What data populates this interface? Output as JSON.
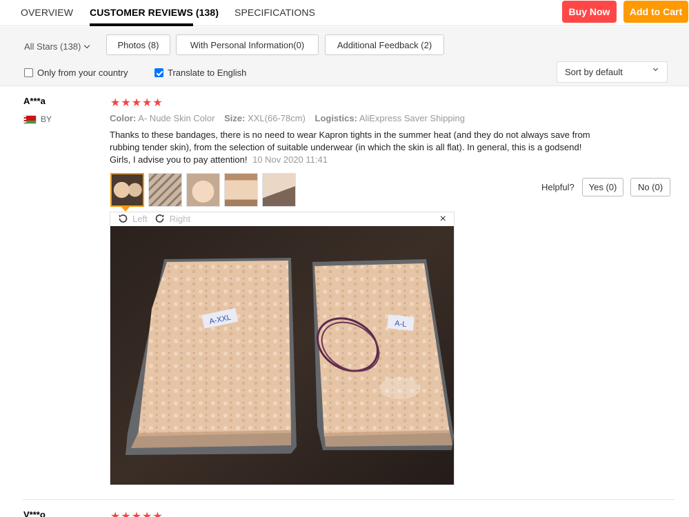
{
  "tabs": [
    {
      "label": "OVERVIEW"
    },
    {
      "label": "CUSTOMER REVIEWS (138)"
    },
    {
      "label": "SPECIFICATIONS"
    }
  ],
  "actions": {
    "buy_now": "Buy Now",
    "add_to_cart": "Add to Cart"
  },
  "colors": {
    "buy_now": "#ff4747",
    "add_to_cart": "#ff9a00",
    "star": "#f24545"
  },
  "filters": {
    "all_stars": "All Stars (138)",
    "photos": "Photos (8)",
    "personal_info": "With Personal Information(0)",
    "additional_feedback": "Additional Feedback (2)",
    "only_country": {
      "label": "Only from your country",
      "checked": false
    },
    "translate": {
      "label": "Translate to English",
      "checked": true
    },
    "sort": "Sort by default"
  },
  "review": {
    "reviewer": "A***a",
    "country": "BY",
    "stars": "★★★★★",
    "rating": 5,
    "color_label": "Color:",
    "color_value": "A- Nude Skin Color",
    "size_label": "Size:",
    "size_value": "XXL(66-78cm)",
    "logistics_label": "Logistics:",
    "logistics_value": "AliExpress Saver Shipping",
    "text": "Thanks to these bandages, there is no need to wear Kapron tights in the summer heat (and they do not always save from rubbing tender skin), from the selection of suitable underwear (in which the skin is all flat). In general, this is a godsend! Girls, I advise you to pay attention!",
    "date": "10 Nov 2020 11:41",
    "helpful_label": "Helpful?",
    "yes": "Yes (0)",
    "no": "No (0)",
    "viewer": {
      "left": "Left",
      "right": "Right",
      "close": "×"
    },
    "photo_labels": [
      "A-XXL",
      "A-L"
    ]
  },
  "next_review": {
    "reviewer": "V***o",
    "stars": "★★★★★"
  }
}
